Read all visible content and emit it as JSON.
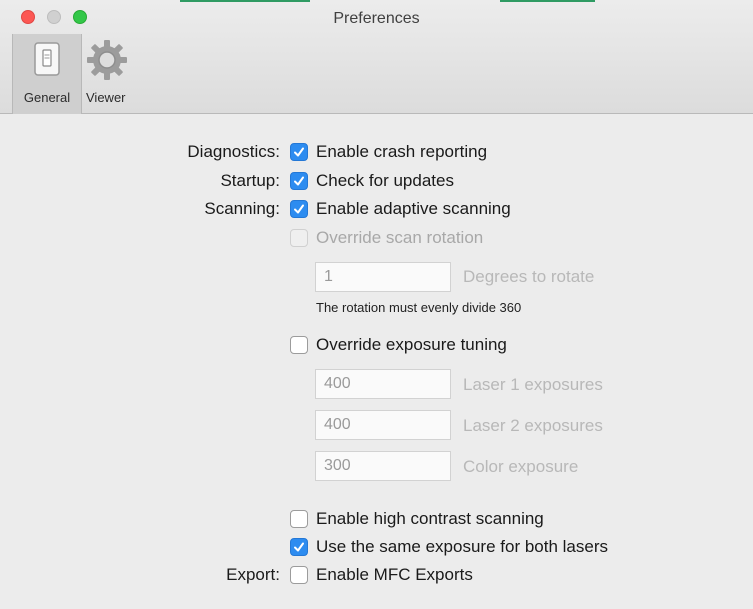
{
  "window": {
    "title": "Preferences"
  },
  "toolbar": {
    "items": [
      {
        "label": "General",
        "icon": "switch-icon"
      },
      {
        "label": "Viewer",
        "icon": "gear-icon"
      }
    ]
  },
  "colors": {
    "accent": "#2d8cf0",
    "close": "#fc5753",
    "zoom": "#33c748"
  },
  "sections": {
    "diagnostics": "Diagnostics:",
    "startup": "Startup:",
    "scanning": "Scanning:",
    "export": "Export:"
  },
  "options": {
    "crash_reporting": {
      "label": "Enable crash reporting",
      "checked": true
    },
    "check_updates": {
      "label": "Check for updates",
      "checked": true
    },
    "adaptive_scanning": {
      "label": "Enable adaptive scanning",
      "checked": true
    },
    "override_rotation": {
      "label": "Override scan rotation",
      "checked": false,
      "disabled": true
    },
    "override_exposure": {
      "label": "Override exposure tuning",
      "checked": false
    },
    "high_contrast": {
      "label": "Enable high contrast scanning",
      "checked": false
    },
    "same_exposure": {
      "label": "Use the same exposure for both lasers",
      "checked": true
    },
    "mfc_exports": {
      "label": "Enable MFC Exports",
      "checked": false
    }
  },
  "rotation": {
    "value": "1",
    "label": "Degrees to rotate",
    "hint": "The rotation must evenly divide 360"
  },
  "exposure": {
    "laser1": {
      "value": "400",
      "label": "Laser 1 exposures"
    },
    "laser2": {
      "value": "400",
      "label": "Laser 2 exposures"
    },
    "color": {
      "value": "300",
      "label": "Color exposure"
    }
  }
}
